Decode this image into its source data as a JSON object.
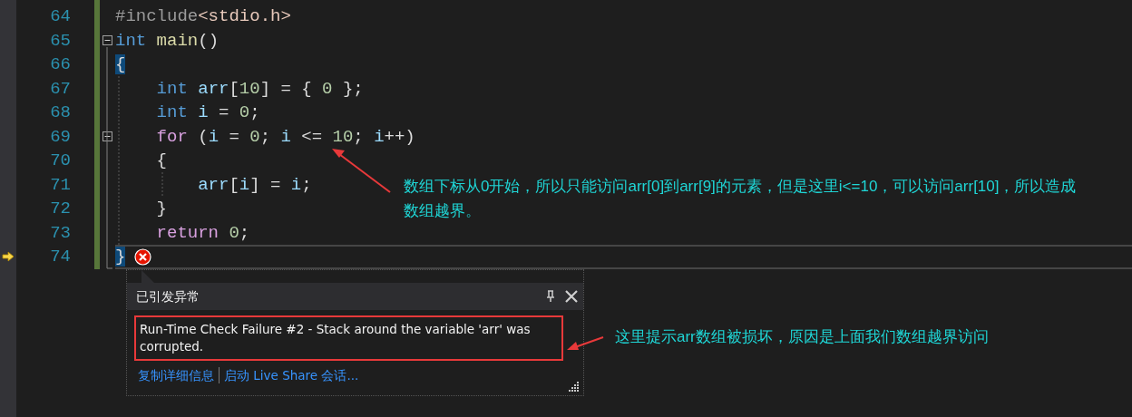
{
  "editor": {
    "lines": [
      {
        "number": "64",
        "current": false,
        "fold_marker": false,
        "error": false,
        "tokens": [
          {
            "kind": "preproc",
            "text": "#include"
          },
          {
            "kind": "header",
            "text": "<stdio.h>"
          }
        ]
      },
      {
        "number": "65",
        "current": false,
        "fold_marker": true,
        "error": false,
        "tokens": [
          {
            "kind": "keyword",
            "text": "int"
          },
          {
            "kind": "function",
            "text": " main"
          },
          {
            "kind": "plain",
            "text": "()"
          }
        ]
      },
      {
        "number": "66",
        "current": false,
        "fold_marker": false,
        "error": false,
        "tokens": [
          {
            "kind": "brace",
            "text": "{"
          }
        ]
      },
      {
        "number": "67",
        "current": false,
        "fold_marker": false,
        "error": false,
        "tokens": [
          {
            "kind": "keyword",
            "text": "    int"
          },
          {
            "kind": "variable",
            "text": " arr"
          },
          {
            "kind": "plain",
            "text": "["
          },
          {
            "kind": "number",
            "text": "10"
          },
          {
            "kind": "plain",
            "text": "] = { "
          },
          {
            "kind": "number",
            "text": "0"
          },
          {
            "kind": "plain",
            "text": " };"
          }
        ]
      },
      {
        "number": "68",
        "current": false,
        "fold_marker": false,
        "error": false,
        "tokens": [
          {
            "kind": "keyword",
            "text": "    int"
          },
          {
            "kind": "variable",
            "text": " i"
          },
          {
            "kind": "plain",
            "text": " = "
          },
          {
            "kind": "number",
            "text": "0"
          },
          {
            "kind": "plain",
            "text": ";"
          }
        ]
      },
      {
        "number": "69",
        "current": false,
        "fold_marker": true,
        "error": false,
        "tokens": [
          {
            "kind": "control",
            "text": "    for"
          },
          {
            "kind": "plain",
            "text": " ("
          },
          {
            "kind": "variable",
            "text": "i"
          },
          {
            "kind": "plain",
            "text": " = "
          },
          {
            "kind": "number",
            "text": "0"
          },
          {
            "kind": "plain",
            "text": "; "
          },
          {
            "kind": "variable",
            "text": "i"
          },
          {
            "kind": "plain",
            "text": " <= "
          },
          {
            "kind": "number",
            "text": "10"
          },
          {
            "kind": "plain",
            "text": "; "
          },
          {
            "kind": "variable",
            "text": "i"
          },
          {
            "kind": "plain",
            "text": "++)"
          }
        ]
      },
      {
        "number": "70",
        "current": false,
        "fold_marker": false,
        "error": false,
        "tokens": [
          {
            "kind": "plain",
            "text": "    {"
          }
        ]
      },
      {
        "number": "71",
        "current": false,
        "fold_marker": false,
        "error": false,
        "tokens": [
          {
            "kind": "variable",
            "text": "        arr"
          },
          {
            "kind": "plain",
            "text": "["
          },
          {
            "kind": "variable",
            "text": "i"
          },
          {
            "kind": "plain",
            "text": "] = "
          },
          {
            "kind": "variable",
            "text": "i"
          },
          {
            "kind": "plain",
            "text": ";"
          }
        ]
      },
      {
        "number": "72",
        "current": false,
        "fold_marker": false,
        "error": false,
        "tokens": [
          {
            "kind": "plain",
            "text": "    }"
          }
        ]
      },
      {
        "number": "73",
        "current": false,
        "fold_marker": false,
        "error": false,
        "tokens": [
          {
            "kind": "control",
            "text": "    return"
          },
          {
            "kind": "number",
            "text": " 0"
          },
          {
            "kind": "plain",
            "text": ";"
          }
        ]
      },
      {
        "number": "74",
        "current": true,
        "fold_marker": false,
        "error": true,
        "tokens": [
          {
            "kind": "brace",
            "text": "}"
          }
        ]
      }
    ]
  },
  "exception_popup": {
    "title": "已引发异常",
    "message": "Run-Time Check Failure #2 - Stack around the variable 'arr' was corrupted.",
    "links": [
      "复制详细信息",
      "启动 Live Share 会话..."
    ]
  },
  "annotations": [
    {
      "text": "数组下标从0开始，所以只能访问arr[0]到arr[9]的元素，但是这里i<=10，可以访问arr[10]，所以造成数组越界。"
    },
    {
      "text": "这里提示arr数组被损坏，原因是上面我们数组越界访问"
    }
  ]
}
